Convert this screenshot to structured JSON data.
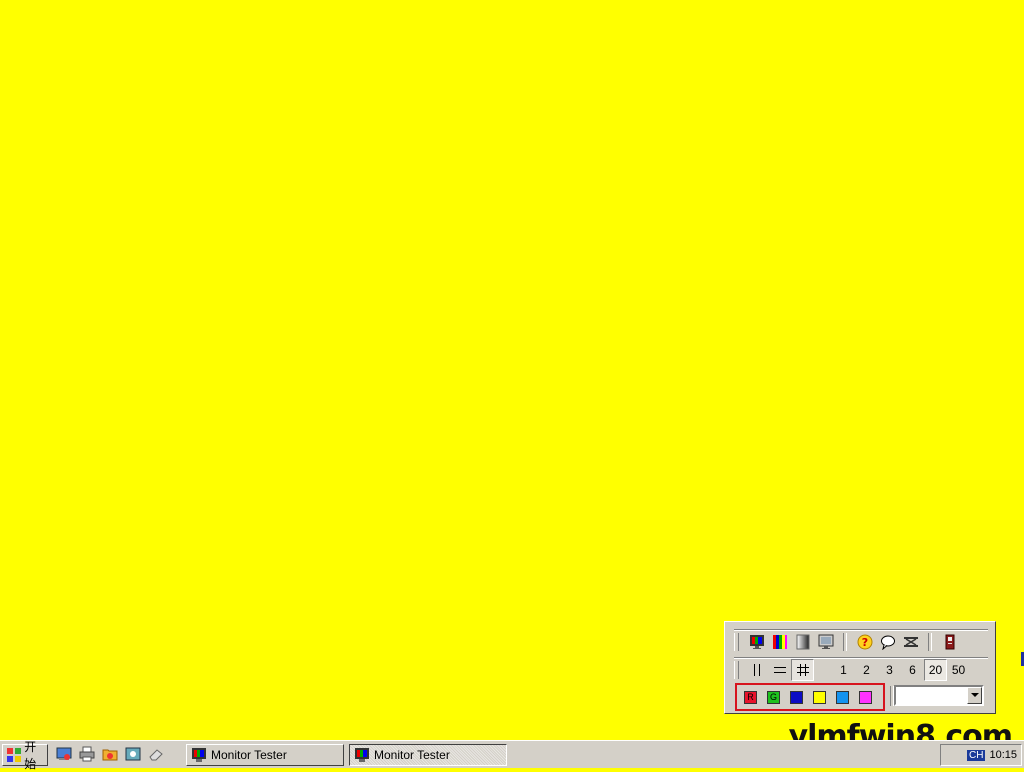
{
  "desktop": {
    "background_color": "#ffff00"
  },
  "toolbar": {
    "row1_icons": [
      "monitor-color-icon",
      "color-bars-icon",
      "gradient-icon",
      "monitor-icon",
      "help-icon",
      "speech-bubble-icon",
      "network-icon",
      "exit-icon"
    ],
    "row2": {
      "line_icons": [
        "vertical-lines-icon",
        "horizontal-lines-icon",
        "grid-icon"
      ],
      "spacing_values": [
        "1",
        "2",
        "3",
        "6",
        "20",
        "50"
      ],
      "selected_spacing": "20"
    },
    "colors": [
      {
        "label": "R",
        "hex": "#e8132c"
      },
      {
        "label": "G",
        "hex": "#1ec21e"
      },
      {
        "label": "",
        "hex": "#0c0cc4"
      },
      {
        "label": "",
        "hex": "#ffff00"
      },
      {
        "label": "",
        "hex": "#1493f0"
      },
      {
        "label": "",
        "hex": "#ff33ff"
      }
    ],
    "dropdown_value": ""
  },
  "taskbar": {
    "start_label": "开始",
    "quick_launch_icons": [
      "desktop-icon",
      "printer-icon",
      "folder-icon",
      "media-icon",
      "eraser-icon"
    ],
    "tasks": [
      {
        "label": "Monitor Tester",
        "active": false
      },
      {
        "label": "Monitor Tester",
        "active": true
      }
    ],
    "tray": {
      "ime": "CH",
      "clock": "10:15"
    }
  },
  "watermark": "ylmfwin8.com"
}
